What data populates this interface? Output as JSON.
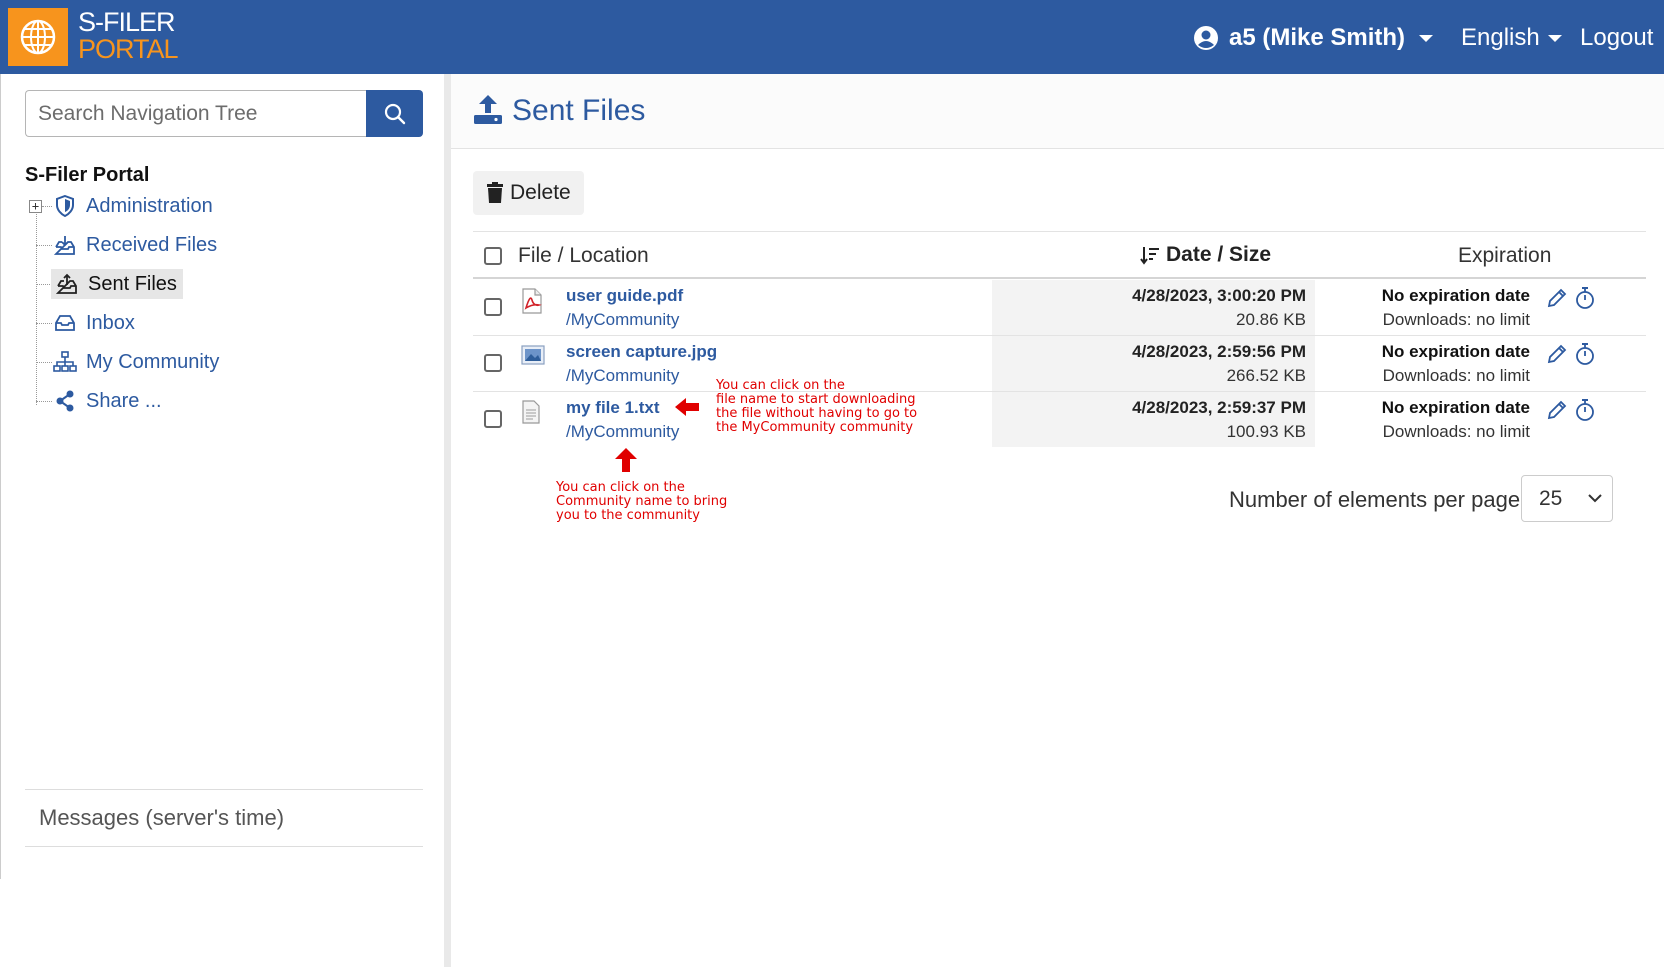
{
  "header": {
    "brand_line1": "S-FILER",
    "brand_line2": "PORTAL",
    "user_label": "a5 (Mike Smith)",
    "language": "English",
    "logout_label": "Logout",
    "colors": {
      "header_bg": "#2d5aa0",
      "brand_accent": "#f7941d"
    }
  },
  "sidebar": {
    "search_placeholder": "Search Navigation Tree",
    "tree_title": "S-Filer Portal",
    "items": [
      {
        "label": "Administration",
        "icon": "shield-icon"
      },
      {
        "label": "Received Files",
        "icon": "inbox-download-icon"
      },
      {
        "label": "Sent Files",
        "icon": "upload-tray-icon",
        "active": true
      },
      {
        "label": "Inbox",
        "icon": "inbox-icon"
      },
      {
        "label": "My Community",
        "icon": "sitemap-icon"
      },
      {
        "label": "Share ...",
        "icon": "share-icon"
      }
    ],
    "messages_label": "Messages (server's time)"
  },
  "main": {
    "title": "Sent Files",
    "delete_label": "Delete",
    "columns": {
      "file": "File / Location",
      "date": "Date / Size",
      "expiration": "Expiration"
    },
    "rows": [
      {
        "name": "user guide.pdf",
        "location": "/MyCommunity",
        "date": "4/28/2023, 3:00:20 PM",
        "size": "20.86 KB",
        "expiration": "No expiration date",
        "downloads": "Downloads: no limit",
        "icon": "pdf-file-icon"
      },
      {
        "name": "screen capture.jpg",
        "location": "/MyCommunity",
        "date": "4/28/2023, 2:59:56 PM",
        "size": "266.52 KB",
        "expiration": "No expiration date",
        "downloads": "Downloads: no limit",
        "icon": "image-file-icon"
      },
      {
        "name": "my file 1.txt",
        "location": "/MyCommunity",
        "date": "4/28/2023, 2:59:37 PM",
        "size": "100.93 KB",
        "expiration": "No expiration date",
        "downloads": "Downloads: no limit",
        "icon": "text-file-icon"
      }
    ],
    "per_page_label": "Number of elements per page",
    "per_page_value": "25"
  },
  "annotations": {
    "file_name_note": [
      "You can click on the",
      "file name to start downloading",
      "the file without having to go to",
      "the MyCommunity community"
    ],
    "community_note": [
      "You can click on the",
      "Community name to bring",
      "you to the community"
    ],
    "color": "#e00000"
  }
}
